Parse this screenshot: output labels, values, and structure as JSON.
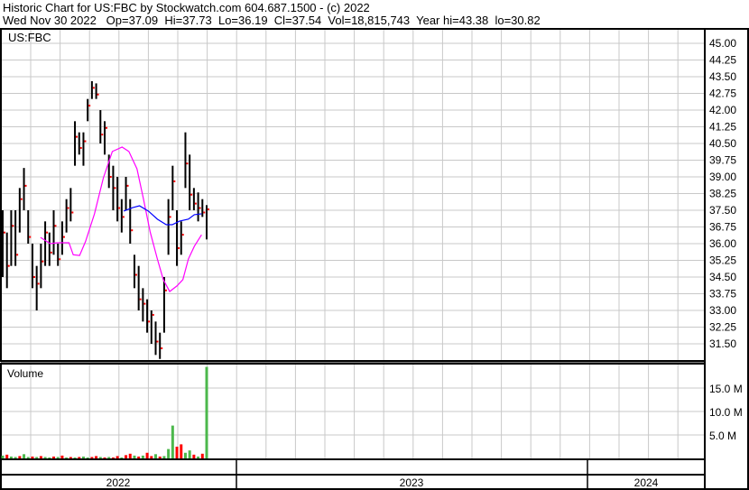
{
  "header": {
    "line1": "Historic Chart for US:FBC by Stockwatch.com 604.687.1500 - (c) 2022",
    "line2": "Wed Nov 30 2022   Op=37.09  Hi=37.73  Lo=36.19  Cl=37.54  Vol=18,815,743  Year hi=43.38  lo=30.82"
  },
  "chart_data": {
    "type": "bar",
    "title": "US:FBC",
    "volume_label": "Volume",
    "price_ticks": [
      "45.00",
      "44.25",
      "43.50",
      "42.75",
      "42.00",
      "41.25",
      "40.50",
      "39.75",
      "39.00",
      "38.25",
      "37.50",
      "36.75",
      "36.00",
      "35.25",
      "34.50",
      "33.75",
      "33.00",
      "32.25",
      "31.50"
    ],
    "price_range": [
      31.13,
      45.4
    ],
    "volume_ticks": [
      "15.0 M",
      "10.0 M",
      "5.0 M"
    ],
    "volume_tick_values": [
      15,
      10,
      5
    ],
    "years": [
      "2022",
      "2023",
      "2024"
    ],
    "ohlc_bars": [
      [
        37.5,
        34.5,
        36.5
      ],
      [
        36.5,
        34,
        35
      ],
      [
        37.5,
        35,
        36.8
      ],
      [
        37.5,
        35,
        35.5
      ],
      [
        38.5,
        36.5,
        38
      ],
      [
        39.4,
        37.5,
        38.6
      ],
      [
        37.5,
        36,
        36.3
      ],
      [
        36,
        34,
        34.5
      ],
      [
        35,
        33,
        34.2
      ],
      [
        36,
        34,
        35.2
      ],
      [
        37,
        35,
        36.5
      ],
      [
        36.5,
        35,
        35.6
      ],
      [
        37.5,
        35.5,
        36.8
      ],
      [
        36,
        35,
        35.3
      ],
      [
        37,
        35.5,
        36.3
      ],
      [
        38,
        36.5,
        37.6
      ],
      [
        38.5,
        37,
        37.4
      ],
      [
        41.5,
        39.5,
        40.8
      ],
      [
        41,
        40,
        40.3
      ],
      [
        41,
        39.5,
        40.6
      ],
      [
        42.5,
        41.5,
        42.2
      ],
      [
        43.3,
        42.5,
        43
      ],
      [
        43.2,
        42.5,
        42.7
      ],
      [
        42,
        40.5,
        40.9
      ],
      [
        41.5,
        40,
        41.2
      ],
      [
        40,
        38.5,
        39
      ],
      [
        39.5,
        37.5,
        38.5
      ],
      [
        39,
        37,
        37.6
      ],
      [
        38,
        36.5,
        37.2
      ],
      [
        39,
        37.5,
        38.6
      ],
      [
        38,
        36,
        36.6
      ],
      [
        35.5,
        34,
        34.6
      ],
      [
        35,
        33,
        33.5
      ],
      [
        34,
        32.5,
        33.3
      ],
      [
        33.5,
        32,
        32.5
      ],
      [
        33,
        31.5,
        32.8
      ],
      [
        32.5,
        31,
        31.6
      ],
      [
        32,
        30.82,
        31.3
      ],
      [
        34.5,
        32,
        33.9
      ],
      [
        38,
        35.5,
        37.2
      ],
      [
        39.5,
        37.5,
        38.8
      ],
      [
        37.5,
        35,
        35.8
      ],
      [
        37,
        35.5,
        36.4
      ],
      [
        41,
        38.5,
        39.6
      ],
      [
        40,
        37.5,
        38.2
      ],
      [
        38.5,
        37.5,
        37.8
      ],
      [
        38.3,
        37,
        37.6
      ],
      [
        38,
        37.2,
        37.4
      ],
      [
        37.73,
        36.19,
        37.54
      ]
    ],
    "ma_magenta": [
      [
        8.9,
        36.28
      ],
      [
        11.2,
        36.0
      ],
      [
        12.9,
        36.04
      ],
      [
        15.6,
        36.04
      ],
      [
        16.6,
        35.5
      ],
      [
        18.1,
        35.47
      ],
      [
        19.5,
        36.1
      ],
      [
        21.6,
        37.34
      ],
      [
        23.7,
        38.96
      ],
      [
        25.8,
        40.14
      ],
      [
        28.1,
        40.34
      ],
      [
        29.7,
        40.14
      ],
      [
        31.6,
        39.36
      ],
      [
        33.1,
        38.03
      ],
      [
        34.7,
        36.53
      ],
      [
        36.4,
        35.31
      ],
      [
        37.8,
        34.38
      ],
      [
        39.3,
        33.85
      ],
      [
        41,
        34.1
      ],
      [
        42.4,
        34.38
      ],
      [
        43.7,
        35.31
      ],
      [
        45.1,
        35.88
      ],
      [
        46.8,
        36.4
      ]
    ],
    "ma_blue": [
      [
        28.5,
        37.46
      ],
      [
        30.6,
        37.62
      ],
      [
        32.2,
        37.7
      ],
      [
        34.3,
        37.46
      ],
      [
        36.4,
        37.1
      ],
      [
        38.5,
        36.85
      ],
      [
        39.9,
        36.85
      ],
      [
        41.6,
        37.01
      ],
      [
        43.7,
        37.1
      ],
      [
        45.1,
        37.3
      ],
      [
        46.8,
        37.34
      ]
    ],
    "volume_millions": [
      0.6,
      0.8,
      0.4,
      0.3,
      0.5,
      0.9,
      0.3,
      0.4,
      0.3,
      0.5,
      0.3,
      0.2,
      0.4,
      0.3,
      0.6,
      0.2,
      0.3,
      0.2,
      0.3,
      0.4,
      0.2,
      0.3,
      0.5,
      0.3,
      0.2,
      0.3,
      0.2,
      0.5,
      0.2,
      0.7,
      1.0,
      0.6,
      0.4,
      0.6,
      1.2,
      0.5,
      0.9,
      0.4,
      0.5,
      2.0,
      7.0,
      2.5,
      3.0,
      1.2,
      1.7,
      0.8,
      0.4,
      1.0,
      19.5
    ],
    "volume_up": [
      1,
      0,
      1,
      1,
      0,
      1,
      1,
      0,
      1,
      0,
      1,
      1,
      0,
      1,
      0,
      1,
      0,
      1,
      0,
      1,
      1,
      0,
      0,
      1,
      0,
      1,
      0,
      0,
      1,
      0,
      0,
      1,
      0,
      1,
      0,
      0,
      1,
      0,
      1,
      1,
      1,
      0,
      0,
      1,
      1,
      0,
      1,
      0,
      1
    ],
    "colors": {
      "grid": "#c8c8c8",
      "bar": "#000000",
      "close_tick": "#ff0000",
      "ma1": "#ff00ff",
      "ma2": "#0000ff",
      "vol_up": "#4cb84c",
      "vol_down": "#ff0000"
    }
  }
}
